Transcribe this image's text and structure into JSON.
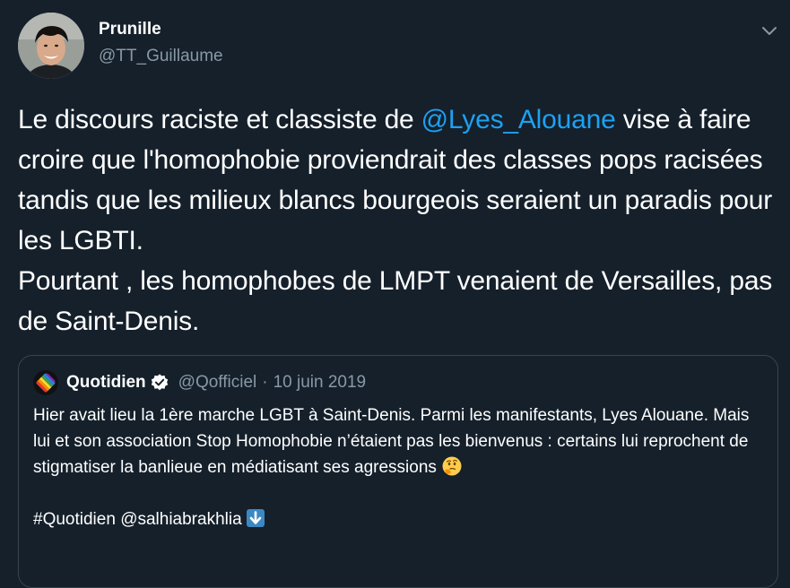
{
  "tweet": {
    "display_name": "Prunille",
    "handle": "@TT_Guillaume",
    "avatar_icon": "user-avatar-photo",
    "menu_icon": "chevron-down-icon",
    "text_part1": "Le discours raciste et classiste de ",
    "mention": "@Lyes_Alouane",
    "text_part2": " vise à faire croire que l'homophobie proviendrait des classes pops racisées tandis que les milieux blancs bourgeois seraient un paradis pour les LGBTI.",
    "text_line2": "Pourtant , les homophobes de LMPT venaient de Versailles, pas de Saint-Denis."
  },
  "quote": {
    "display_name": "Quotidien",
    "verified_icon": "verified-badge-icon",
    "handle": "@Qofficiel",
    "separator": "·",
    "date": "10 juin 2019",
    "text": "Hier avait lieu la 1ère marche LGBT à Saint-Denis. Parmi les manifestants, Lyes Alouane. Mais lui et son association Stop Homophobie n’étaient pas les bienvenus : certains lui reprochent de stigmatiser la banlieue en médiatisant ses agressions",
    "thinking_emoji": "thinking-face-emoji",
    "hashtag": "#Quotidien",
    "mention": "@salhiabrakhlia",
    "down_arrow_emoji": "down-arrow-emoji"
  },
  "colors": {
    "background": "#15202b",
    "text": "#ffffff",
    "secondary_text": "#8899a6",
    "link": "#1da1f2",
    "border": "#38444d"
  }
}
